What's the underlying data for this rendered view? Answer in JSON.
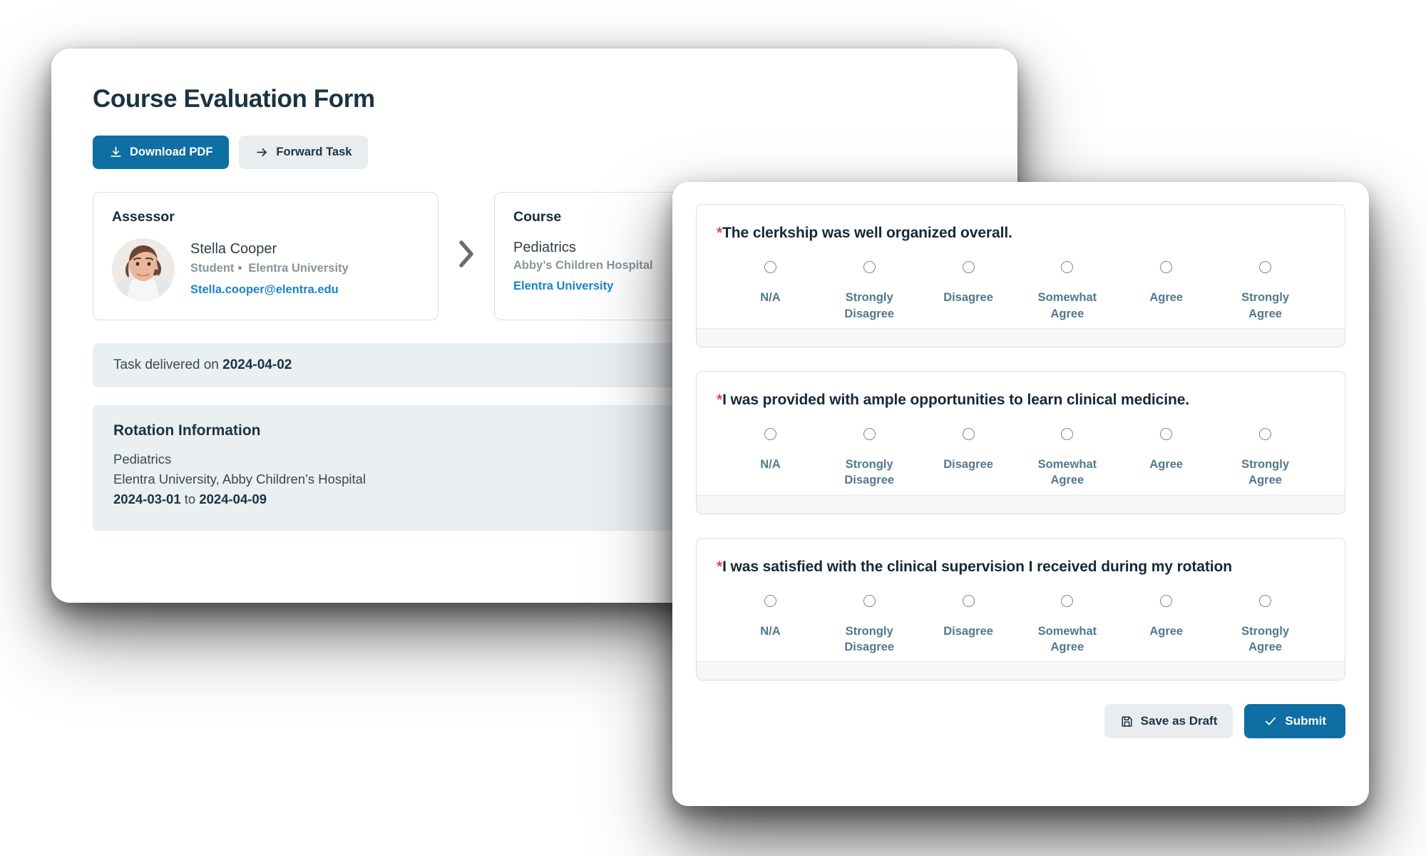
{
  "theme": {
    "accent_blue": "#0f6ea3",
    "link_blue": "#1884c7",
    "heading_navy": "#1b3342",
    "muted_gray": "#8a949d",
    "scale_label_blue": "#53788c",
    "required_red": "#e8445c",
    "strip_gray": "#eaeff2",
    "card_border": "#d9dfe4"
  },
  "back_panel": {
    "title": "Course Evaluation Form",
    "actions": [
      {
        "label": "Download PDF",
        "icon": "download-icon",
        "style": "primary"
      },
      {
        "label": "Forward Task",
        "icon": "arrow-right-icon",
        "style": "secondary"
      }
    ],
    "assessor_card": {
      "title": "Assessor",
      "avatar_alt": "avatar",
      "name": "Stella Cooper",
      "role": "Student",
      "organization": "Elentra University",
      "email": "Stella.cooper@elentra.edu"
    },
    "separator_icon": "chevron-right-icon",
    "course_card": {
      "title": "Course",
      "name": "Pediatrics",
      "site": "Abby’s Children Hospital",
      "organization": "Elentra University"
    },
    "delivered_strip": {
      "prefix": "Task delivered on ",
      "date": "2024-04-02"
    },
    "rotation_card": {
      "title": "Rotation Information",
      "course": "Pediatrics",
      "location": "Elentra University, Abby Children’s Hospital",
      "start_date": "2024-03-01",
      "range_joiner": " to ",
      "end_date": "2024-04-09"
    }
  },
  "front_panel": {
    "scale_options": [
      "N/A",
      "Strongly Disagree",
      "Disagree",
      "Somewhat Agree",
      "Agree",
      "Strongly Agree"
    ],
    "required_marker": "*",
    "questions": [
      {
        "text": "The clerkship was well organized overall.",
        "required": true
      },
      {
        "text": "I was provided with ample opportunities to learn clinical medicine.",
        "required": true
      },
      {
        "text": "I was satisfied with the clinical supervision I received during my rotation",
        "required": true
      }
    ],
    "actions": [
      {
        "label": "Save as Draft",
        "icon": "save-icon",
        "style": "secondary"
      },
      {
        "label": "Submit",
        "icon": "check-icon",
        "style": "primary"
      }
    ]
  }
}
